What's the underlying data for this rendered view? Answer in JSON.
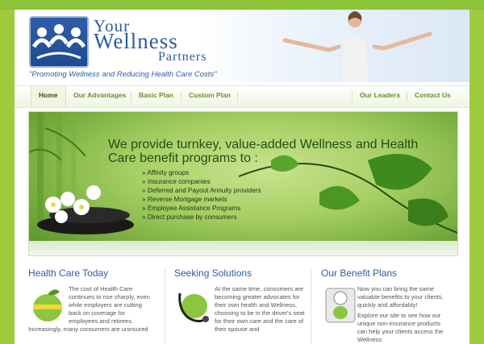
{
  "logo": {
    "line1": "Your",
    "line2": "Wellness",
    "line3": "Partners",
    "tagline": "\"Promoting Wellness and Reducing Health Care Costs\""
  },
  "nav": {
    "items": [
      {
        "label": "Home"
      },
      {
        "label": "Our Advantages"
      },
      {
        "label": "Basic Plan"
      },
      {
        "label": "Custom Plan"
      },
      {
        "label": "Our Leaders"
      },
      {
        "label": "Contact Us"
      }
    ]
  },
  "banner": {
    "headline": "We provide turnkey, value-added Wellness and Health Care benefit programs to :",
    "bullets": [
      "Affinity groups",
      "Insurance companies",
      "Deferred and Payout Annuity providers",
      "Reverse Mortgage markets",
      "Employee Assistance Programs",
      "Direct purchase by consumers"
    ]
  },
  "columns": [
    {
      "title": "Health Care Today",
      "text1": "The cost of Health Care continues to rise sharply, even while employers are cutting back on coverage for employees and retirees.",
      "text2": "Increasingly, many consumers are uninsured",
      "icon": "apple-tape-icon"
    },
    {
      "title": "Seeking Solutions",
      "text1": "At the same time, consumers are becoming greater advocates for their own health and Wellness, choosing to be in the driver's seat for their own care and the care of their spouse and",
      "icon": "green-apple-stethoscope-icon"
    },
    {
      "title": "Our Benefit Plans",
      "text1": "Now you can bring the same valuable benefits to your clients, quickly and affordably!",
      "text2": "Explore our site to see how our unique non-insurance products can help your clients access the Wellness",
      "icon": "scale-icon"
    }
  ],
  "colors": {
    "outer_bg": "#9fcb3f",
    "title_blue": "#2c5da0",
    "nav_green": "#6b8f2a",
    "banner_text": "#1f4f17"
  }
}
